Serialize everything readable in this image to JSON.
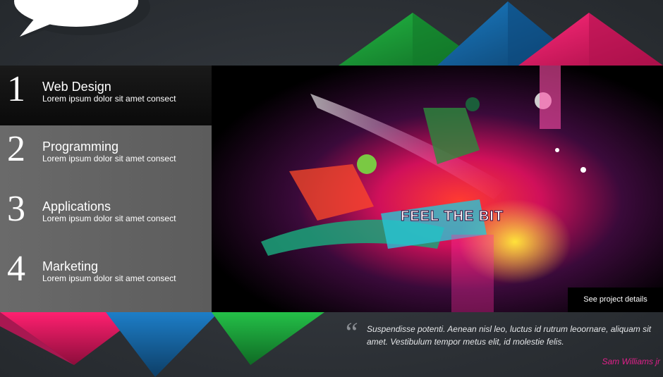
{
  "menu": {
    "items": [
      {
        "number": "1",
        "title": "Web Design",
        "desc": "Lorem ipsum dolor sit amet consect"
      },
      {
        "number": "2",
        "title": "Programming",
        "desc": "Lorem ipsum dolor sit amet consect"
      },
      {
        "number": "3",
        "title": "Applications",
        "desc": "Lorem ipsum dolor sit amet consect"
      },
      {
        "number": "4",
        "title": "Marketing",
        "desc": "Lorem ipsum dolor sit amet consect"
      }
    ],
    "active_index": 0
  },
  "hero": {
    "artwork_text": "FEEL THE BIT",
    "details_label": "See project details"
  },
  "testimonial": {
    "quote_mark": "“",
    "text": "Suspendisse potenti. Aenean nisl leo, luctus id rutrum leoornare, aliquam sit amet. Vestibulum tempor metus elit, id molestie felis.",
    "author": "Sam Williams jr"
  },
  "colors": {
    "pink": "#e0175f",
    "blue": "#1569a8",
    "green": "#1fa23a",
    "accent_author": "#e0208a"
  }
}
